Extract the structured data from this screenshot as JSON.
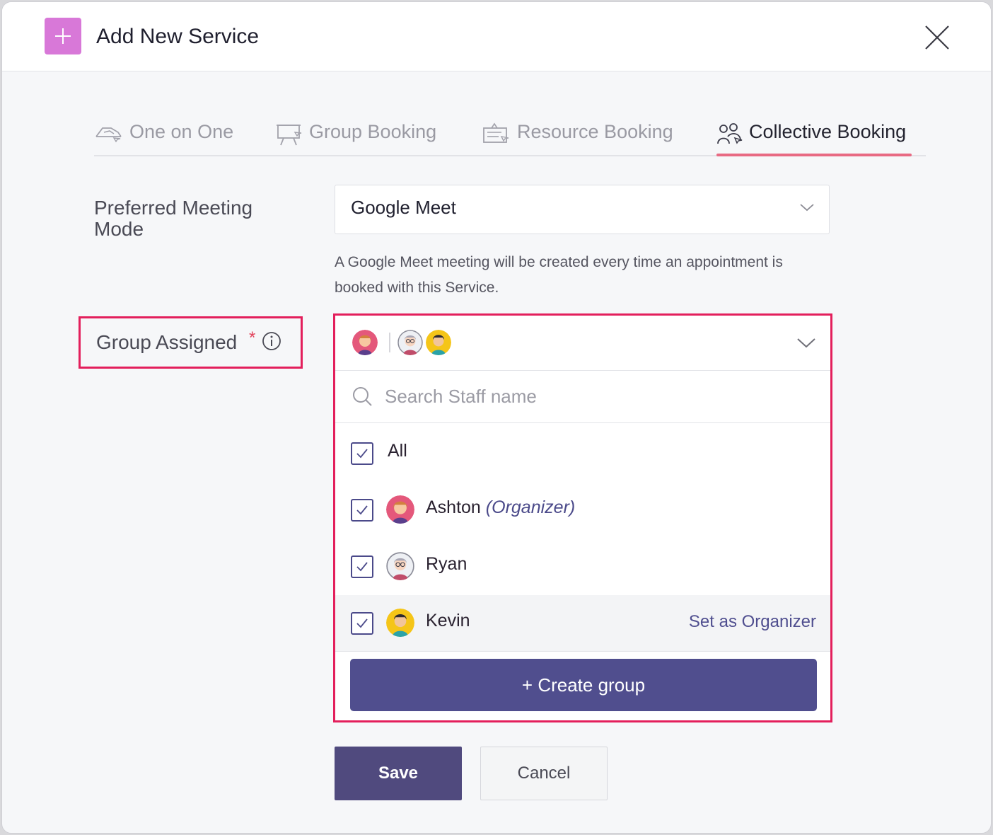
{
  "header": {
    "title": "Add New Service"
  },
  "tabs": [
    {
      "label": "One on One",
      "icon": "handshake-icon"
    },
    {
      "label": "Group Booking",
      "icon": "presentation-board-icon"
    },
    {
      "label": "Resource Booking",
      "icon": "desk-resource-icon"
    },
    {
      "label": "Collective Booking",
      "icon": "people-group-icon",
      "active": true
    }
  ],
  "meeting_mode": {
    "label_line1": "Preferred Meeting",
    "label_line2": "Mode",
    "value": "Google Meet",
    "hint": "A Google Meet meeting will be created every time an appointment is booked with this Service."
  },
  "group": {
    "label": "Group Assigned",
    "required_mark": "*",
    "search_placeholder": "Search Staff name",
    "all_label": "All",
    "members": [
      {
        "name": "Ashton",
        "tag": "(Organizer)",
        "checked": true
      },
      {
        "name": "Ryan",
        "tag": "",
        "checked": true
      },
      {
        "name": "Kevin",
        "tag": "",
        "checked": true,
        "action": "Set as Organizer"
      }
    ],
    "create_label": "+ Create group"
  },
  "actions": {
    "save": "Save",
    "cancel": "Cancel"
  },
  "colors": {
    "accent": "#504e8e",
    "highlight_border": "#e31f5c",
    "tab_underline": "#e86a83",
    "plus_badge": "#d878d8"
  }
}
